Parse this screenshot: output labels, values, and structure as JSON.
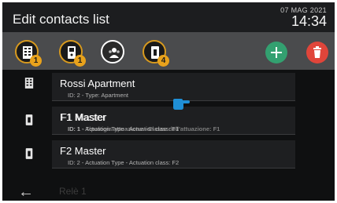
{
  "header": {
    "title": "Edit contacts list",
    "date": "07 MAG 2021",
    "time": "14:34"
  },
  "toolbar": {
    "filters": [
      {
        "icon": "apartment-building-icon",
        "badge": "1"
      },
      {
        "icon": "door-entry-panel-icon",
        "badge": "1"
      },
      {
        "icon": "user-group-icon",
        "badge": ""
      },
      {
        "icon": "actuator-module-icon",
        "badge": "4"
      }
    ],
    "add_icon": "plus-icon",
    "delete_icon": "trash-icon",
    "colors": {
      "accent": "#e8a21c",
      "add": "#33a070",
      "delete": "#e0453a"
    }
  },
  "list": {
    "items": [
      {
        "name": "Rossi Apartment",
        "details": "ID: 2 - Type: Apartment",
        "icon": "apartment-building-icon"
      },
      {
        "name": "F1 Master",
        "details": "ID: 1 - Actuation Type - Actuation class: F1",
        "icon": "actuator-module-icon",
        "overlay_name": "F1 Master",
        "overlay_details": "ID: 1 - Tipologia attuazione - Classe dell'attuazione: F1"
      },
      {
        "name": "F2 Master",
        "details": "ID: 2 - Actuation Type - Actuation class: F2",
        "icon": "actuator-module-icon"
      }
    ],
    "partial_item": "Relè 1"
  },
  "footer": {
    "back_icon": "back-arrow-icon"
  }
}
